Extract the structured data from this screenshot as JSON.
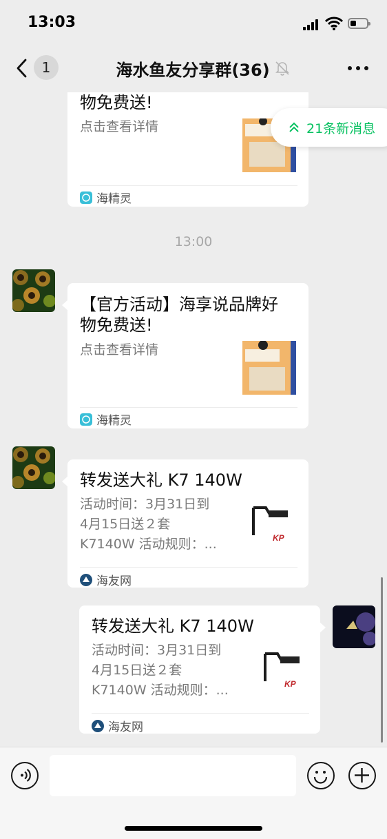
{
  "status_bar": {
    "time": "13:03",
    "battery_level": 0.35
  },
  "nav": {
    "back_icon": "chevron-left-icon",
    "unread_count": "1",
    "title": "海水鱼友分享群(36)",
    "mute_icon": "bell-muted-icon",
    "more_icon": "more-icon"
  },
  "new_messages": {
    "label": "21条新消息",
    "icon": "double-chevron-up-icon",
    "color": "#07c160"
  },
  "messages": [
    {
      "title_tail": "物免费送!",
      "desc": "点击查看详情",
      "source": "海精灵"
    },
    {
      "time": "13:00"
    },
    {
      "title_line1": "【官方活动】海享说品牌好",
      "title_line2": "物免费送!",
      "desc": "点击查看详情",
      "source": "海精灵"
    },
    {
      "title": "转发送大礼 K7 140W",
      "desc_line1": "活动时间：3月31日到",
      "desc_line2": "4月15日送２套",
      "desc_line3": "K7140W 活动规则：...",
      "source": "海友网"
    },
    {
      "title": "转发送大礼 K7 140W",
      "desc_line1": "活动时间：3月31日到",
      "desc_line2": "4月15日送２套",
      "desc_line3": "K7140W 活动规则：...",
      "source": "海友网"
    }
  ],
  "input_bar": {
    "voice_icon": "voice-icon",
    "emoji_icon": "emoji-icon",
    "add_icon": "plus-icon"
  },
  "colors": {
    "background": "#ededed",
    "card": "#ffffff",
    "accent": "#07c160"
  }
}
